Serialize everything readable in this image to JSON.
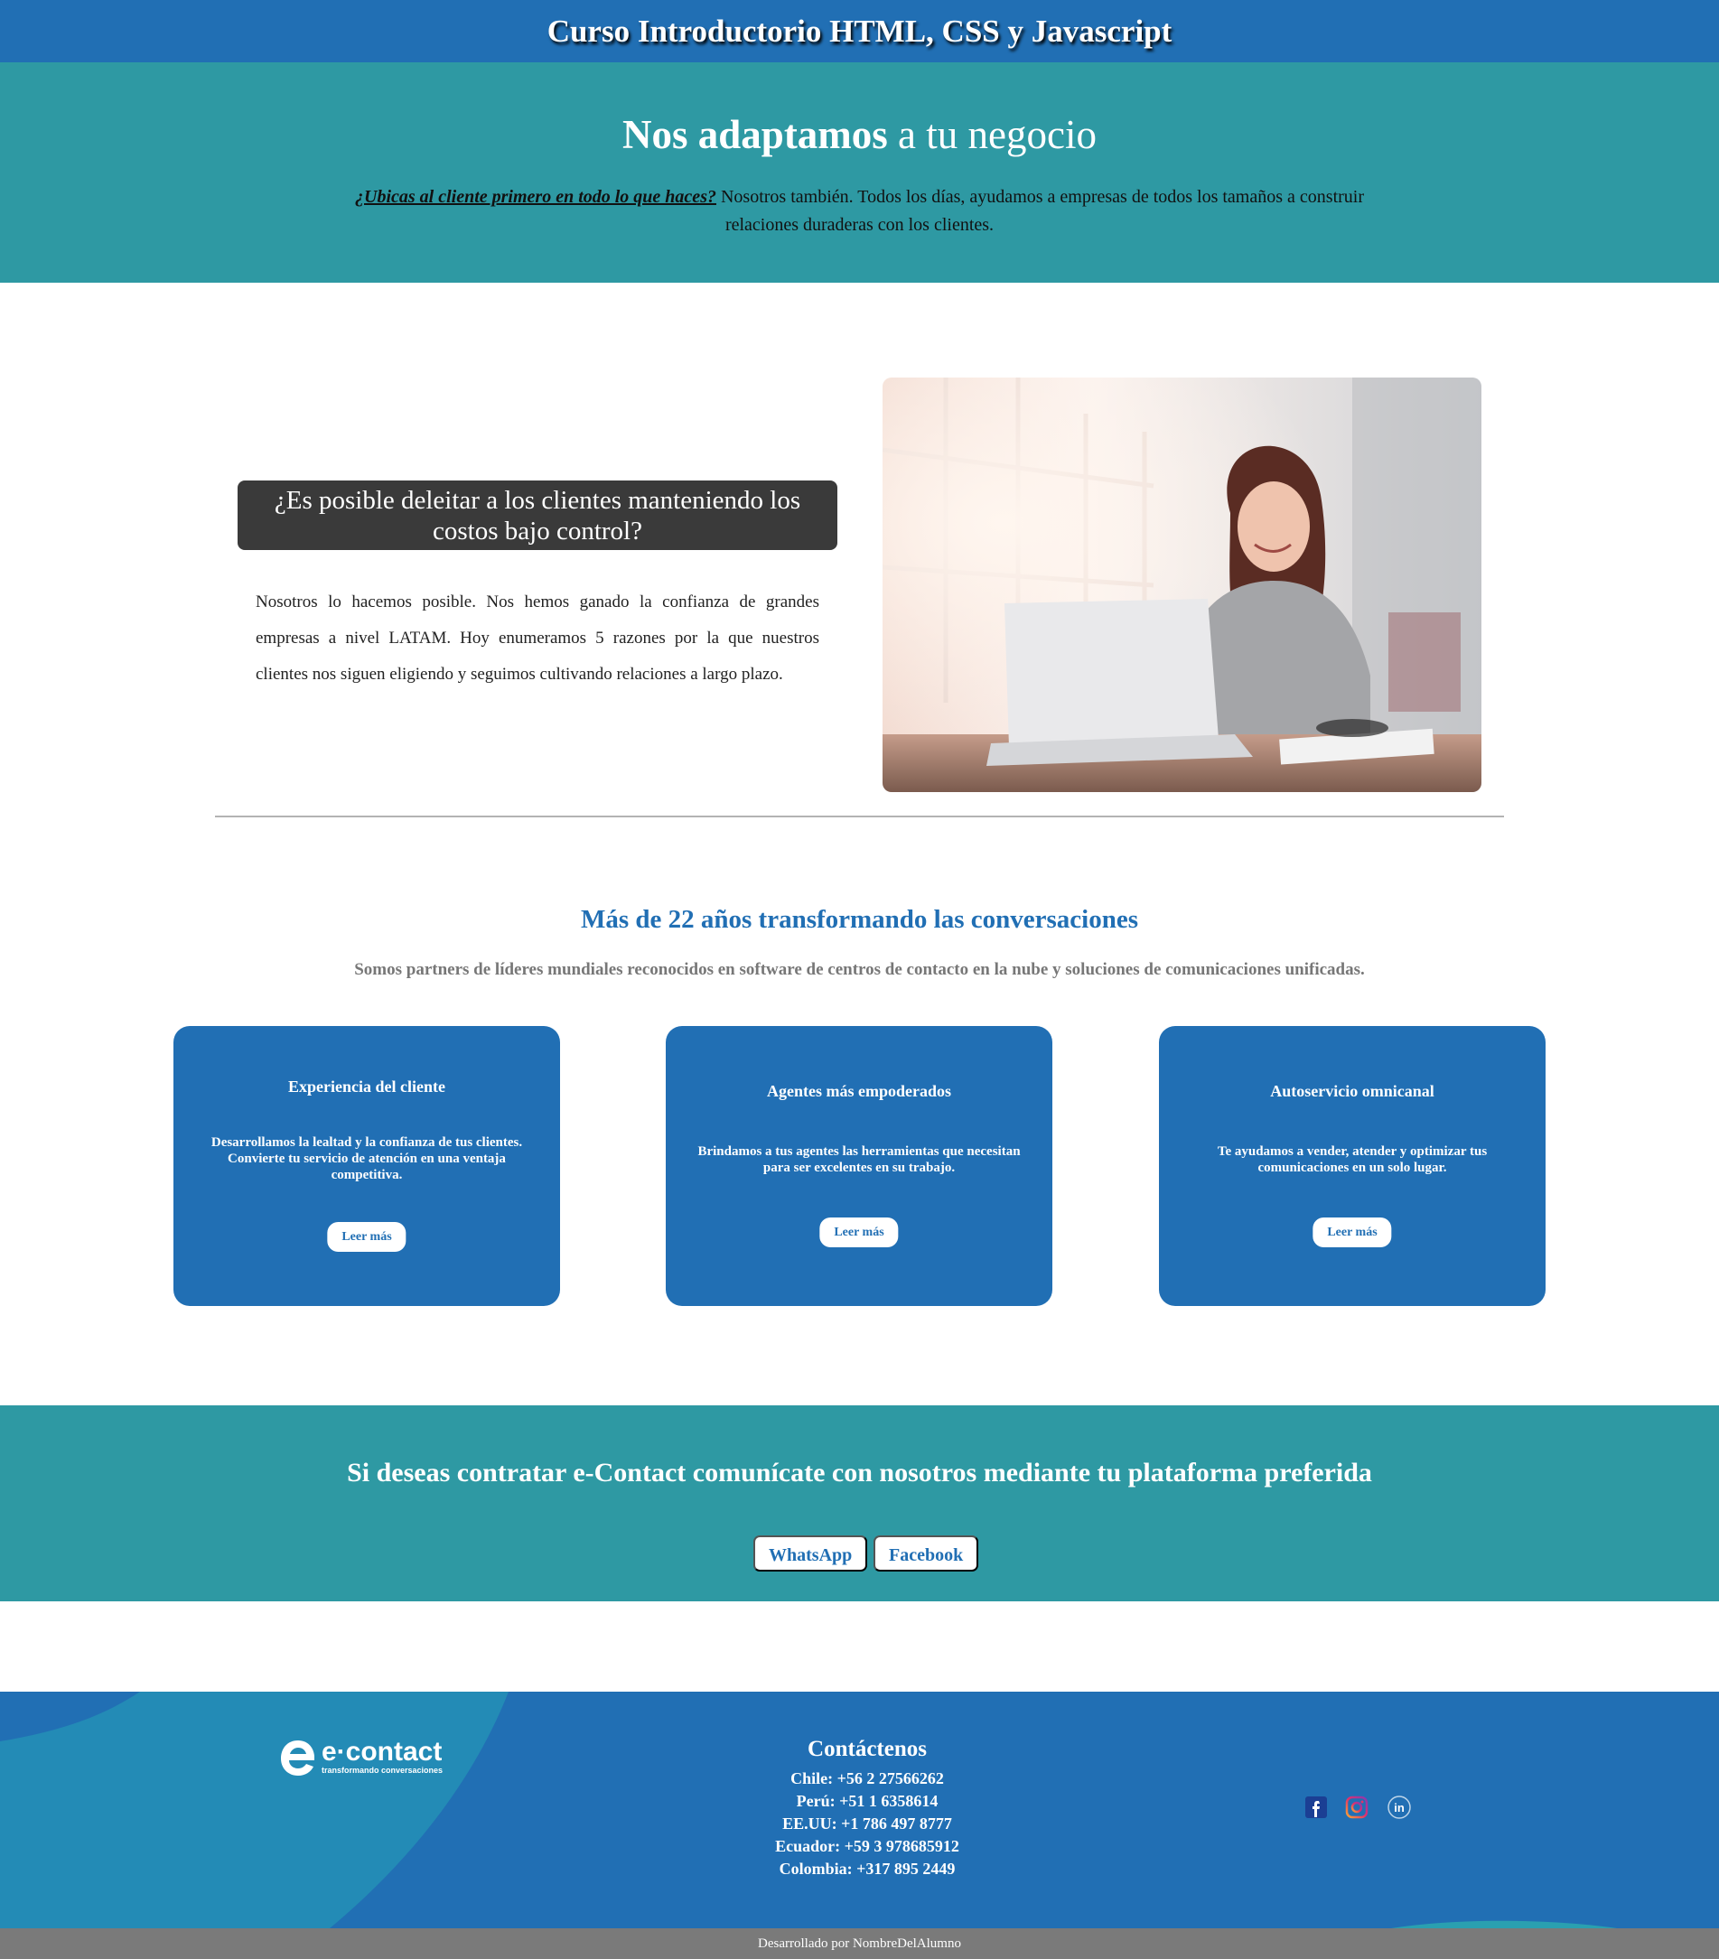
{
  "header": {
    "title": "Curso Introductorio HTML, CSS y Javascript"
  },
  "hero": {
    "title_bold": "Nos adaptamos",
    "title_rest": " a tu negocio",
    "link_text": "¿Ubicas al cliente primero en todo lo que haces?",
    "text": " Nosotros también. Todos los días, ayudamos a empresas de todos los tamaños a construir relaciones duraderas con los clientes."
  },
  "section1": {
    "question": "¿Es posible deleitar a los clientes manteniendo los costos bajo control?",
    "text": "Nosotros lo hacemos posible. Nos hemos ganado la confianza de grandes empresas a nivel LATAM. Hoy enumeramos 5 razones por la que nuestros clientes nos siguen eligiendo y seguimos cultivando relaciones a largo plazo."
  },
  "section2": {
    "title": "Más de 22 años transformando las conversaciones",
    "subtitle": "Somos partners de líderes mundiales reconocidos en software de centros de contacto en la nube y soluciones de comunicaciones unificadas.",
    "cards": [
      {
        "title": "Experiencia del cliente",
        "text": "Desarrollamos la lealtad y la confianza de tus clientes. Convierte tu servicio de atención en una ventaja competitiva.",
        "button": "Leer más"
      },
      {
        "title": "Agentes más empoderados",
        "text": "Brindamos a tus agentes las herramientas que necesitan para ser excelentes en su trabajo.",
        "button": "Leer más"
      },
      {
        "title": "Autoservicio omnicanal",
        "text": "Te ayudamos a vender, atender y optimizar tus comunicaciones en un solo lugar.",
        "button": "Leer más"
      }
    ]
  },
  "contact_banner": {
    "title": "Si deseas contratar e-Contact comunícate con nosotros mediante tu plataforma preferida",
    "buttons": [
      "WhatsApp",
      "Facebook"
    ]
  },
  "footer": {
    "logo_name": "e·contact",
    "logo_tagline": "transformando conversaciones",
    "contact_title": "Contáctenos",
    "phones": [
      "Chile: +56 2 27566262",
      "Perú: +51 1 6358614",
      "EE.UU: +1 786 497 8777",
      "Ecuador: +59 3 978685912",
      "Colombia: +317 895 2449"
    ],
    "social_icons": [
      "facebook-icon",
      "instagram-icon",
      "linkedin-icon"
    ],
    "credit": "Desarrollado por NombreDelAlumno"
  },
  "colors": {
    "blue": "#216fb4",
    "teal": "#2e99a3",
    "dark": "#3a3a3a",
    "gray_bar": "#7a7a7a"
  }
}
